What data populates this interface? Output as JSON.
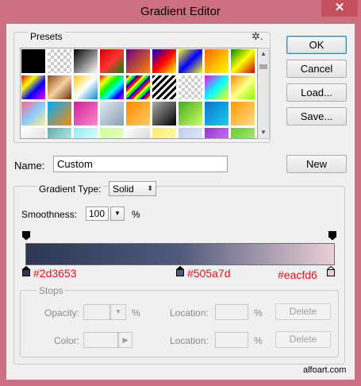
{
  "window": {
    "title": "Gradient Editor",
    "close_glyph": "✕"
  },
  "presets": {
    "label": "Presets",
    "gear_glyph": "✲.",
    "swatches": [
      "linear-gradient(135deg,#000,#000)",
      "repeating-conic-gradient(#ccc 0 25%,#fff 0 50%) 0 0/8px 8px",
      "linear-gradient(135deg,#000,#fff)",
      "linear-gradient(135deg,#cc0000,#ff3333 50%,#008800)",
      "linear-gradient(135deg,#6a0080,#ff8800)",
      "linear-gradient(135deg,#0000cc,#ff0000 50%,#ffff00)",
      "linear-gradient(135deg,#ffff00,#0000ff 50%,#ffff00)",
      "linear-gradient(135deg,#ff6600,#ffff00)",
      "linear-gradient(135deg,#008800,#ffff00 50%,#cc0000)",
      "linear-gradient(135deg,#ff0000,#ffff00 30%,#0000ff 60%,#ff00ff)",
      "linear-gradient(135deg,#8a4a1a,#f5d0a0 50%,#6a3010)",
      "linear-gradient(135deg,#ffcc00,#fff 50%,#0088cc)",
      "linear-gradient(135deg,#ff0000,#ffff00 20%,#00ff00 40%,#00ffff 60%,#0000ff 80%,#ff00ff)",
      "repeating-linear-gradient(135deg,#ff0000 0 3px,#ffff00 3px 6px,#00ff00 6px 9px,#0000ff 9px 12px)",
      "repeating-linear-gradient(135deg,#000 0 3px,#fff 3px 6px)",
      "repeating-conic-gradient(#ccc 0 25%,#fff 0 50%) 0 0/8px 8px",
      "linear-gradient(135deg,#ff00ff,#00ffff 50%,#ffff00)",
      "linear-gradient(135deg,#ff8800,#ffff88 50%,#88ff00)",
      "linear-gradient(135deg,#ff6688,#88ccff 50%,#ffee88)",
      "linear-gradient(135deg,#00aaff,#ff8800)",
      "linear-gradient(135deg,#cc2299,#ff88cc)",
      "linear-gradient(135deg,#e0e8f0,#8aa0b8)",
      "linear-gradient(135deg,#ff8800,#ffcc66)",
      "linear-gradient(135deg,#aaaaaa,#000000)",
      "linear-gradient(135deg,#44aa22,#ccff66)",
      "linear-gradient(135deg,#0077cc,#22ccee)",
      "linear-gradient(135deg,#ff9900,#ffdd88)",
      "linear-gradient(135deg,#ffffff,#d8d8d8)",
      "linear-gradient(135deg,#66aaaa,#ccffff)",
      "linear-gradient(135deg,#88eeff,#ffffff)",
      "linear-gradient(135deg,#ccff99,#eeffcc)",
      "linear-gradient(135deg,#ffffff,#cccccc)",
      "linear-gradient(135deg,#ffee66,#fffbcc)",
      "linear-gradient(135deg,#bbccee,#eef4ff)",
      "linear-gradient(135deg,#9933cc,#cc88ff)",
      "linear-gradient(135deg,#66cc33,#bbee88)"
    ]
  },
  "buttons": {
    "ok": "OK",
    "cancel": "Cancel",
    "load": "Load...",
    "save": "Save...",
    "new": "New",
    "delete_opacity": "Delete",
    "delete_color": "Delete"
  },
  "name_field": {
    "label": "Name:",
    "value": "Custom"
  },
  "gradient": {
    "type_label": "Gradient Type:",
    "type_value": "Solid",
    "smoothness_label": "Smoothness:",
    "smoothness_value": "100",
    "smoothness_unit": "%",
    "color_stops": [
      {
        "hex": "#2d3653",
        "label": "#2d3653",
        "location_pct": 0
      },
      {
        "hex": "#505a7d",
        "label": "#505a7d",
        "location_pct": 50
      },
      {
        "hex": "#eacfd6",
        "label": "#eacfd6",
        "location_pct": 100
      }
    ]
  },
  "stops": {
    "label": "Stops",
    "opacity_label": "Opacity:",
    "opacity_unit": "%",
    "color_label": "Color:",
    "location_label_1": "Location:",
    "location_unit_1": "%",
    "location_label_2": "Location:",
    "location_unit_2": "%"
  },
  "watermark": "alfoart.com",
  "colors": {
    "window_frame": "#cc6f80",
    "close_button": "#c7505f",
    "dialog_bg": "#f0f0f0",
    "hex_label": "#e8101c"
  }
}
